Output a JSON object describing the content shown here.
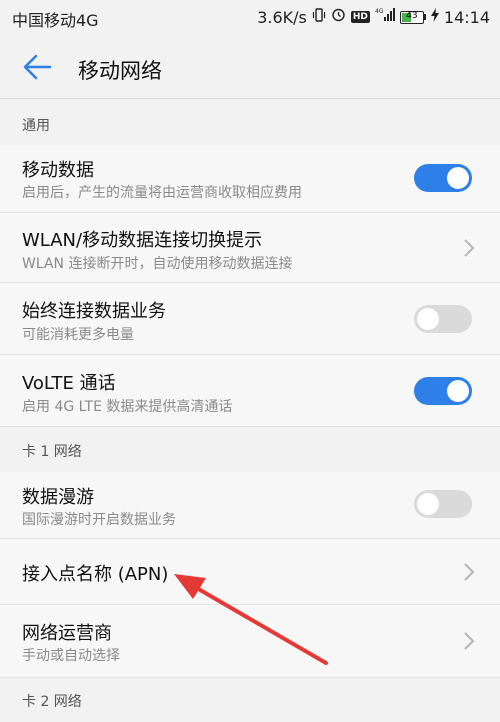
{
  "status_bar": {
    "carrier": "中国移动4G",
    "speed": "3.6K/s",
    "network": "4G",
    "battery": "43",
    "time": "14:14"
  },
  "header": {
    "title": "移动网络"
  },
  "sections": {
    "general": "通用",
    "card1": "卡 1 网络",
    "card2": "卡 2 网络"
  },
  "rows": {
    "mobile_data": {
      "title": "移动数据",
      "subtitle": "启用后，产生的流量将由运营商收取相应费用",
      "enabled": true
    },
    "wlan_switch": {
      "title": "WLAN/移动数据连接切换提示",
      "subtitle": "WLAN 连接断开时，自动使用移动数据连接"
    },
    "always_on": {
      "title": "始终连接数据业务",
      "subtitle": "可能消耗更多电量",
      "enabled": false
    },
    "volte": {
      "title": "VoLTE 通话",
      "subtitle": "启用 4G LTE 数据来提供高清通话",
      "enabled": true
    },
    "roaming": {
      "title": "数据漫游",
      "subtitle": "国际漫游时开启数据业务",
      "enabled": false
    },
    "apn": {
      "title": "接入点名称 (APN)"
    },
    "carrier_select": {
      "title": "网络运营商",
      "subtitle": "手动或自动选择"
    }
  },
  "colors": {
    "accent": "#2f7fe8",
    "annotation_arrow": "#e53935"
  }
}
